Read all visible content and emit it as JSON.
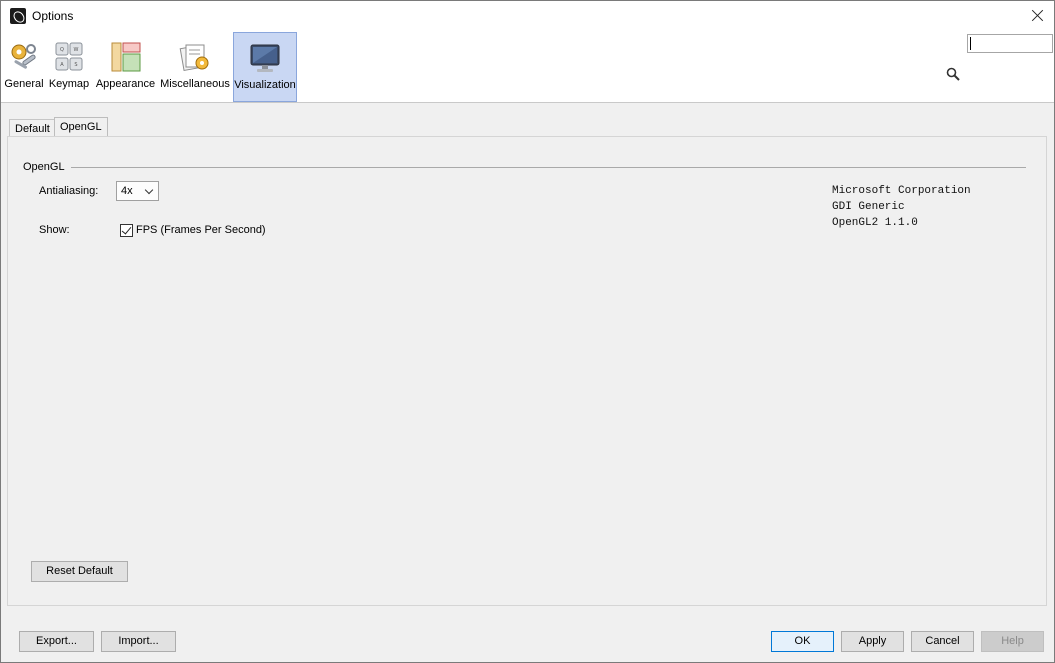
{
  "window": {
    "title": "Options"
  },
  "categories": [
    {
      "label": "General",
      "icon": "wrench-gear-icon"
    },
    {
      "label": "Keymap",
      "icon": "keyboard-keys-icon"
    },
    {
      "label": "Appearance",
      "icon": "palette-panels-icon"
    },
    {
      "label": "Miscellaneous",
      "icon": "documents-gear-icon"
    },
    {
      "label": "Visualization",
      "icon": "monitor-icon",
      "selected": true
    }
  ],
  "search": {
    "placeholder": "",
    "value": ""
  },
  "tabs": [
    {
      "label": "Default"
    },
    {
      "label": "OpenGL",
      "active": true
    }
  ],
  "opengl": {
    "group_title": "OpenGL",
    "antialiasing_label": "Antialiasing:",
    "antialiasing_value": "4x",
    "show_label": "Show:",
    "fps_label": "FPS (Frames Per Second)",
    "fps_checked": true,
    "info_lines": [
      "Microsoft Corporation",
      "GDI Generic",
      "OpenGL2 1.1.0"
    ]
  },
  "buttons": {
    "reset_default": "Reset Default",
    "export": "Export...",
    "import": "Import...",
    "ok": "OK",
    "apply": "Apply",
    "cancel": "Cancel",
    "help": "Help"
  },
  "colors": {
    "selected_category_bg": "#c9d7f3",
    "primary_button_border": "#0078d7"
  }
}
